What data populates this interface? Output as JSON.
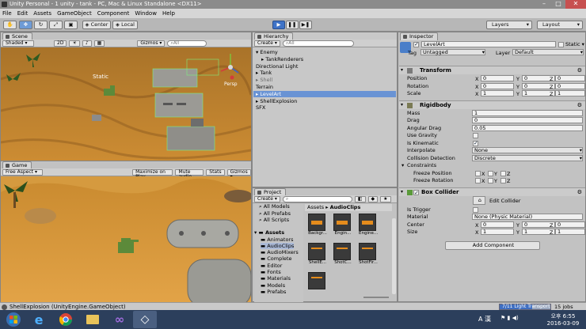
{
  "window": {
    "title": "Unity Personal - 1 unity - tank - PC, Mac & Linux Standalone <DX11>"
  },
  "menu": [
    "File",
    "Edit",
    "Assets",
    "GameObject",
    "Component",
    "Window",
    "Help"
  ],
  "toolbar": {
    "pivot": "Center",
    "space": "Local",
    "layers": "Layers",
    "layout": "Layout"
  },
  "scene": {
    "tab": "Scene",
    "shading": "Shaded",
    "mode": "2D",
    "gizmos": "Gizmos",
    "search_placeholder": "All",
    "label_static": "Static",
    "label_persp": "Persp"
  },
  "game": {
    "tab": "Game",
    "aspect": "Free Aspect",
    "maximize": "Maximize on Play",
    "mute": "Mute audio",
    "stats": "Stats",
    "gizmos": "Gizmos"
  },
  "hierarchy": {
    "tab": "Hierarchy",
    "create": "Create",
    "search_placeholder": "All",
    "items": [
      {
        "label": "Enemy",
        "indent": 0,
        "expanded": true,
        "state": "normal"
      },
      {
        "label": "TankRenderers",
        "indent": 1,
        "expanded": false,
        "state": "normal"
      },
      {
        "label": "Directional Light",
        "indent": 0,
        "state": "normal"
      },
      {
        "label": "Tank",
        "indent": 0,
        "expanded": false,
        "state": "normal"
      },
      {
        "label": "Shell",
        "indent": 0,
        "expanded": false,
        "state": "dim"
      },
      {
        "label": "Terrain",
        "indent": 0,
        "state": "normal"
      },
      {
        "label": "LevelArt",
        "indent": 0,
        "expanded": false,
        "state": "selected"
      },
      {
        "label": "ShellExplosion",
        "indent": 0,
        "expanded": false,
        "state": "normal"
      },
      {
        "label": "SFX",
        "indent": 0,
        "state": "normal"
      }
    ]
  },
  "project": {
    "tab": "Project",
    "create": "Create",
    "favorites": [
      "All Models",
      "All Prefabs",
      "All Scripts"
    ],
    "assets_root": "Assets",
    "folders": [
      "Animators",
      "AudioClips",
      "AudioMixers",
      "Complete",
      "Editor",
      "Fonts",
      "Materials",
      "Models",
      "Prefabs"
    ],
    "breadcrumb": [
      "Assets",
      "AudioClips"
    ],
    "clips": [
      {
        "label": "Backgr...",
        "style": "wave"
      },
      {
        "label": "Engin...",
        "style": "wave"
      },
      {
        "label": "Engine...",
        "style": "wave"
      },
      {
        "label": "ShellE...",
        "style": "flat"
      },
      {
        "label": "ShotC...",
        "style": "flat"
      },
      {
        "label": "ShotFir...",
        "style": "flat"
      }
    ]
  },
  "inspector": {
    "tab": "Inspector",
    "object_name": "LevelArt",
    "static_label": "Static",
    "tag_label": "Tag",
    "tag_value": "Untagged",
    "layer_label": "Layer",
    "layer_value": "Default",
    "transform": {
      "title": "Transform",
      "position_label": "Position",
      "position": [
        "0",
        "0",
        "0"
      ],
      "rotation_label": "Rotation",
      "rotation": [
        "0",
        "0",
        "0"
      ],
      "scale_label": "Scale",
      "scale": [
        "1",
        "1",
        "1"
      ]
    },
    "rigidbody": {
      "title": "Rigidbody",
      "mass_label": "Mass",
      "mass": "1",
      "drag_label": "Drag",
      "drag": "0",
      "angular_drag_label": "Angular Drag",
      "angular_drag": "0.05",
      "use_gravity_label": "Use Gravity",
      "use_gravity": false,
      "is_kinematic_label": "Is Kinematic",
      "is_kinematic": true,
      "interpolate_label": "Interpolate",
      "interpolate": "None",
      "collision_label": "Collision Detection",
      "collision": "Discrete",
      "constraints_label": "Constraints",
      "freeze_position_label": "Freeze Position",
      "freeze_rotation_label": "Freeze Rotation"
    },
    "box_collider": {
      "title": "Box Collider",
      "edit_collider": "Edit Collider",
      "is_trigger_label": "Is Trigger",
      "material_label": "Material",
      "material": "None (Physic Material)",
      "center_label": "Center",
      "center": [
        "0",
        "0",
        "0"
      ],
      "size_label": "Size",
      "size": [
        "1",
        "1",
        "1"
      ]
    },
    "add_component": "Add Component",
    "axis": [
      "X",
      "Y",
      "Z"
    ]
  },
  "status": {
    "message": "ShellExplosion (UnityEngine.GameObject)",
    "progress_label": "7/11 Light Transport",
    "progress": 0.64,
    "jobs": "15 jobs"
  },
  "taskbar": {
    "ime": "A 漢",
    "time": "오후 6:55",
    "date": "2016-03-09"
  },
  "colors": {
    "selection": "#6993d4",
    "play_button": "#3f73c7",
    "sand": "#d79a3c",
    "taskbar": "#2c3f5c"
  }
}
